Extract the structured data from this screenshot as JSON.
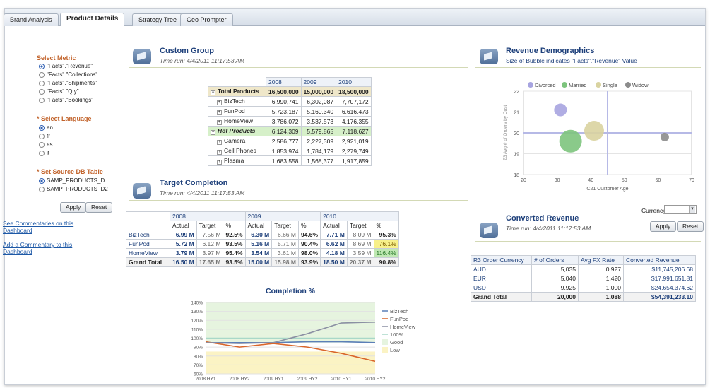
{
  "tabs": [
    "Brand Analysis",
    "Product Details",
    "Strategy Tree",
    "Geo Prompter"
  ],
  "active_tab": 1,
  "sidebar": {
    "metric_title": "Select Metric",
    "metrics": [
      "\"Facts\".\"Revenue\"",
      "\"Facts\".\"Collections\"",
      "\"Facts\".\"Shipments\"",
      "\"Facts\".\"Qty\"",
      "\"Facts\".\"Bookings\""
    ],
    "metric_selected": 0,
    "language_title": "* Select Language",
    "languages": [
      "en",
      "fr",
      "es",
      "it"
    ],
    "language_selected": 0,
    "source_title": "* Set Source DB Table",
    "sources": [
      "SAMP_PRODUCTS_D",
      "SAMP_PRODUCTS_D2"
    ],
    "source_selected": 0,
    "apply": "Apply",
    "reset": "Reset",
    "link1": "See Commentaries on this Dashboard",
    "link2": "Add a Commentary to this Dashboard"
  },
  "custom_group": {
    "title": "Custom Group",
    "timerun": "Time run: 4/4/2011 11:17:53 AM",
    "years": [
      "2008",
      "2009",
      "2010"
    ],
    "rows": [
      {
        "name": "Total Products",
        "vals": [
          "16,500,000",
          "15,000,000",
          "18,500,000"
        ],
        "kind": "total"
      },
      {
        "name": "BizTech",
        "vals": [
          "6,990,741",
          "6,302,087",
          "7,707,172"
        ],
        "kind": "child"
      },
      {
        "name": "FunPod",
        "vals": [
          "5,723,187",
          "5,160,340",
          "6,616,473"
        ],
        "kind": "child"
      },
      {
        "name": "HomeView",
        "vals": [
          "3,786,072",
          "3,537,573",
          "4,176,355"
        ],
        "kind": "child"
      },
      {
        "name": "Hot Products",
        "vals": [
          "6,124,309",
          "5,579,865",
          "7,118,627"
        ],
        "kind": "hot"
      },
      {
        "name": "Camera",
        "vals": [
          "2,586,777",
          "2,227,309",
          "2,921,019"
        ],
        "kind": "child"
      },
      {
        "name": "Cell Phones",
        "vals": [
          "1,853,974",
          "1,784,179",
          "2,279,749"
        ],
        "kind": "child"
      },
      {
        "name": "Plasma",
        "vals": [
          "1,683,558",
          "1,568,377",
          "1,917,859"
        ],
        "kind": "child"
      }
    ]
  },
  "target_completion": {
    "title": "Target Completion",
    "timerun": "Time run: 4/4/2011 11:17:53 AM",
    "years": [
      "2008",
      "2009",
      "2010"
    ],
    "subheaders": [
      "Actual",
      "Target",
      "%"
    ],
    "rows": [
      {
        "name": "BizTech",
        "vals": [
          "6.99 M",
          "7.56 M",
          "92.5%",
          "6.30 M",
          "6.66 M",
          "94.6%",
          "7.71 M",
          "8.09 M",
          "95.3%"
        ],
        "hl": ""
      },
      {
        "name": "FunPod",
        "vals": [
          "5.72 M",
          "6.12 M",
          "93.5%",
          "5.16 M",
          "5.71 M",
          "90.4%",
          "6.62 M",
          "8.69 M",
          "76.1%"
        ],
        "hl": "yellow"
      },
      {
        "name": "HomeView",
        "vals": [
          "3.79 M",
          "3.97 M",
          "95.4%",
          "3.54 M",
          "3.61 M",
          "98.0%",
          "4.18 M",
          "3.59 M",
          "116.4%"
        ],
        "hl": "green"
      }
    ],
    "grand": {
      "name": "Grand Total",
      "vals": [
        "16.50 M",
        "17.65 M",
        "93.5%",
        "15.00 M",
        "15.98 M",
        "93.9%",
        "18.50 M",
        "20.37 M",
        "90.8%"
      ]
    }
  },
  "revenue_demographics": {
    "title": "Revenue Demographics",
    "subtitle": "Size of Bubble indicates \"Facts\".\"Revenue\" Value"
  },
  "converted_revenue": {
    "title": "Converted Revenue",
    "timerun": "Time run: 4/4/2011 11:17:53 AM",
    "currency_label": "Currency",
    "apply": "Apply",
    "reset": "Reset",
    "headers": [
      "R3 Order Currency",
      "# of Orders",
      "Avg FX Rate",
      "Converted Revenue"
    ],
    "rows": [
      [
        "AUD",
        "5,035",
        "0.927",
        "$11,745,206.68"
      ],
      [
        "EUR",
        "5,040",
        "1.420",
        "$17,991,651.81"
      ],
      [
        "USD",
        "9,925",
        "1.000",
        "$24,654,374.62"
      ]
    ],
    "grand": [
      "Grand Total",
      "20,000",
      "1.088",
      "$54,391,233.10"
    ]
  },
  "chart_data": [
    {
      "type": "scatter",
      "title": "",
      "xlabel": "C21 Customer Age",
      "ylabel": "Z3 Avg # of Orders by Cust",
      "xlim": [
        20,
        70
      ],
      "ylim": [
        18,
        22
      ],
      "xticks": [
        "20",
        "30",
        "40",
        "50",
        "60",
        "70"
      ],
      "yticks": [
        "18",
        "19",
        "20",
        "21",
        "22"
      ],
      "legend": [
        "Divorced",
        "Married",
        "Single",
        "Widow"
      ],
      "colors": [
        "#a7a4e0",
        "#7dc47d",
        "#d9d3a0",
        "#8c8c8c"
      ],
      "series": [
        {
          "name": "Divorced",
          "x": 31,
          "y": 21.1,
          "size": 9
        },
        {
          "name": "Married",
          "x": 34,
          "y": 19.6,
          "size": 16
        },
        {
          "name": "Single",
          "x": 41,
          "y": 20.1,
          "size": 14
        },
        {
          "name": "Widow",
          "x": 62,
          "y": 19.8,
          "size": 6
        }
      ],
      "ref_x": 45,
      "ref_y": 20
    },
    {
      "type": "line",
      "title": "Completion %",
      "x": [
        "2008 HY1",
        "2008 HY2",
        "2009 HY1",
        "2009 HY2",
        "2010 HY1",
        "2010 HY2"
      ],
      "ylim": [
        60,
        140
      ],
      "yticks": [
        "60%",
        "70%",
        "80%",
        "90%",
        "100%",
        "110%",
        "120%",
        "130%",
        "140%"
      ],
      "series": [
        {
          "name": "BizTech",
          "values": [
            95,
            95,
            95,
            96,
            96,
            95
          ],
          "color": "#5b7fb7"
        },
        {
          "name": "FunPod",
          "values": [
            96,
            90,
            94,
            90,
            83,
            74
          ],
          "color": "#d9662b"
        },
        {
          "name": "HomeView",
          "values": [
            95,
            94,
            95,
            105,
            117,
            118
          ],
          "color": "#8b8fa3"
        }
      ],
      "reference": {
        "name": "100%",
        "value": 100
      },
      "bands": [
        {
          "name": "Good",
          "from": 95,
          "to": 140,
          "color": "#e6f4df"
        },
        {
          "name": "Low",
          "from": 60,
          "to": 85,
          "color": "#fbf3c4"
        }
      ]
    }
  ]
}
